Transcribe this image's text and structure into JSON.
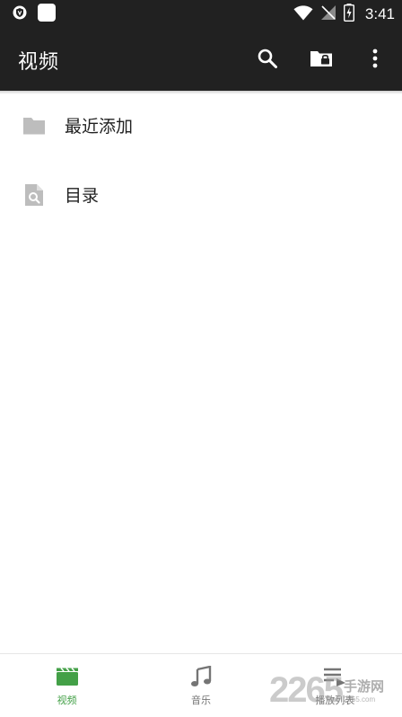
{
  "status_bar": {
    "time": "3:41",
    "icons": [
      "shield-icon",
      "notification-icon",
      "wifi-icon",
      "no-signal-icon",
      "battery-charging-icon"
    ]
  },
  "app_bar": {
    "title": "视频",
    "actions": [
      "search-icon",
      "lock-folder-icon",
      "more-vert-icon"
    ]
  },
  "list": {
    "items": [
      {
        "label": "最近添加",
        "icon": "folder-icon"
      },
      {
        "label": "目录",
        "icon": "file-search-icon"
      }
    ]
  },
  "bottom_nav": {
    "items": [
      {
        "label": "视频",
        "icon": "clapperboard-icon",
        "active": true
      },
      {
        "label": "音乐",
        "icon": "music-note-icon",
        "active": false
      },
      {
        "label": "播放列表",
        "icon": "playlist-icon",
        "active": false
      }
    ]
  },
  "watermark": {
    "number": "2265",
    "text": "手游网",
    "url": "2265.com"
  },
  "colors": {
    "bar": "#212121",
    "accent": "#43a047",
    "text": "#212121",
    "icon_grey": "#bdbdbd"
  }
}
